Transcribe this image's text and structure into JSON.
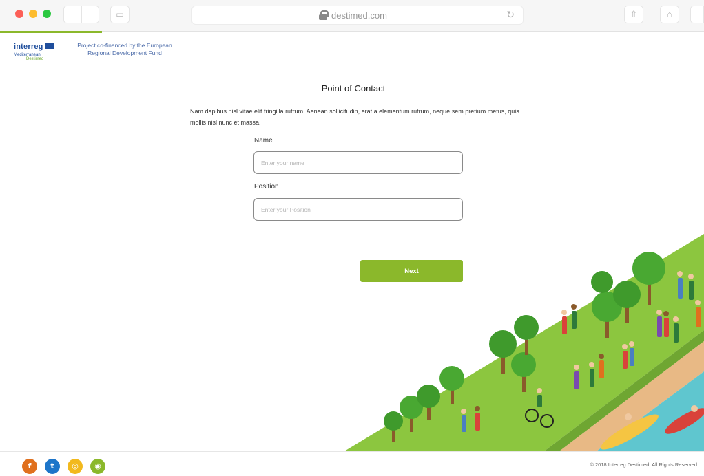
{
  "browser": {
    "url": "destimed.com"
  },
  "header": {
    "logo_text": "interreg",
    "logo_sub": "Mediterranean",
    "logo_sub2": "Destimed",
    "cofinance_text": "Project co-financed by the European Regional Development Fund"
  },
  "form": {
    "title": "Point of Contact",
    "intro": "Nam dapibus nisl vitae elit fringilla rutrum. Aenean sollicitudin, erat a elementum rutrum, neque sem pretium metus, quis mollis nisl nunc et massa.",
    "name_label": "Name",
    "name_placeholder": "Enter your name",
    "position_label": "Position",
    "position_placeholder": "Enter your Position",
    "next_label": "Next"
  },
  "footer": {
    "social": [
      {
        "name": "facebook",
        "glyph": "f",
        "color": "#e0701e"
      },
      {
        "name": "twitter",
        "glyph": "t",
        "color": "#1d75c9"
      },
      {
        "name": "instagram",
        "glyph": "◎",
        "color": "#f2b91d"
      },
      {
        "name": "rss",
        "glyph": "◉",
        "color": "#8bb82b"
      }
    ],
    "copyright": "© 2018 Interreg Destimed. All Rights Reserved"
  },
  "colors": {
    "accent": "#8bb82b",
    "grass": "#8cc63f",
    "path": "#e8b985",
    "water": "#5fc6cf"
  }
}
